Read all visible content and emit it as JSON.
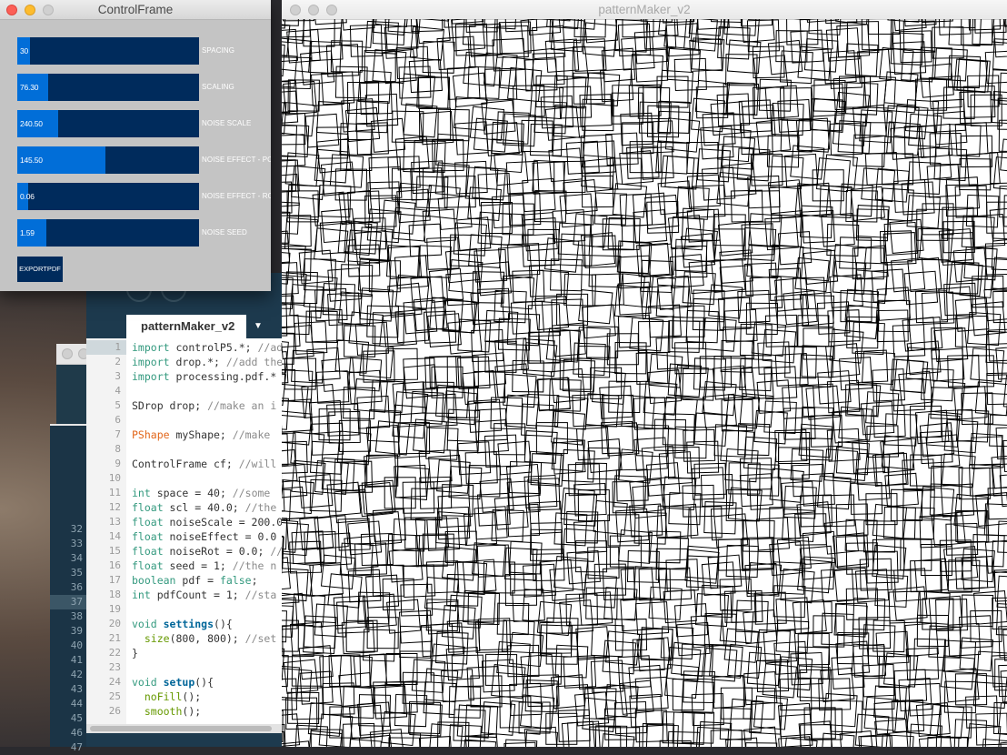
{
  "control_frame": {
    "title": "ControlFrame",
    "sliders": [
      {
        "value_text": "30",
        "label": "SPACING",
        "fill": 0.07
      },
      {
        "value_text": "76.30",
        "label": "SCALING",
        "fill": 0.17
      },
      {
        "value_text": "240.50",
        "label": "NOISE SCALE",
        "fill": 0.225
      },
      {
        "value_text": "145.50",
        "label": "NOISE EFFECT - POS",
        "fill": 0.485
      },
      {
        "value_text": "0.06",
        "label": "NOISE EFFECT - ROT",
        "fill": 0.06
      },
      {
        "value_text": "1.59",
        "label": "NOISE SEED",
        "fill": 0.16
      }
    ],
    "export_button": "EXPORTPDF"
  },
  "pattern_window": {
    "title": "patternMaker_v2"
  },
  "ide": {
    "tab_label": "patternMaker_v2",
    "tab_menu_icon": "chevron-down-icon",
    "current_line": 1,
    "code_lines": [
      [
        [
          "kw",
          "import"
        ],
        [
          "",
          "controlP5.*; "
        ],
        [
          "cm",
          "//ad"
        ]
      ],
      [
        [
          "kw",
          "import"
        ],
        [
          "",
          "drop.*; "
        ],
        [
          "cm",
          "//add the"
        ]
      ],
      [
        [
          "kw",
          "import"
        ],
        [
          "",
          "processing.pdf.*"
        ]
      ],
      [],
      [
        [
          "",
          "SDrop drop; "
        ],
        [
          "cm",
          "//make an i"
        ]
      ],
      [],
      [
        [
          "ty",
          "PShape"
        ],
        [
          "",
          "myShape; "
        ],
        [
          "cm",
          "//make"
        ]
      ],
      [],
      [
        [
          "",
          "ControlFrame cf; "
        ],
        [
          "cm",
          "//will"
        ]
      ],
      [],
      [
        [
          "kw",
          "int"
        ],
        [
          "",
          "space = 40; "
        ],
        [
          "cm",
          "//some"
        ]
      ],
      [
        [
          "kw",
          "float"
        ],
        [
          "",
          "scl = 40.0; "
        ],
        [
          "cm",
          "//the"
        ]
      ],
      [
        [
          "kw",
          "float"
        ],
        [
          "",
          "noiseScale = 200.0"
        ]
      ],
      [
        [
          "kw",
          "float"
        ],
        [
          "",
          "noiseEffect = 0.0"
        ]
      ],
      [
        [
          "kw",
          "float"
        ],
        [
          "",
          "noiseRot = 0.0; "
        ],
        [
          "cm",
          "//"
        ]
      ],
      [
        [
          "kw",
          "float"
        ],
        [
          "",
          "seed = 1; "
        ],
        [
          "cm",
          "//the n"
        ]
      ],
      [
        [
          "kw",
          "boolean"
        ],
        [
          "",
          "pdf = "
        ],
        [
          "kw",
          "false"
        ],
        [
          "",
          ";"
        ]
      ],
      [
        [
          "kw",
          "int"
        ],
        [
          "",
          "pdfCount = 1; "
        ],
        [
          "cm",
          "//sta"
        ]
      ],
      [],
      [
        [
          "kw",
          "void"
        ],
        [
          "fn",
          "settings"
        ],
        [
          "",
          "(){"
        ]
      ],
      [
        [
          "",
          "  "
        ],
        [
          "bfn",
          "size"
        ],
        [
          "",
          "(800, 800); "
        ],
        [
          "cm",
          "//set"
        ]
      ],
      [
        [
          "",
          "}"
        ]
      ],
      [],
      [
        [
          "kw",
          "void"
        ],
        [
          "fn",
          "setup"
        ],
        [
          "",
          "(){"
        ]
      ],
      [
        [
          "",
          "  "
        ],
        [
          "bfn",
          "noFill"
        ],
        [
          "",
          "();"
        ]
      ],
      [
        [
          "",
          "  "
        ],
        [
          "bfn",
          "smooth"
        ],
        [
          "",
          "();"
        ]
      ],
      [
        [
          "",
          "  "
        ]
      ]
    ],
    "line_numbers": [
      "1",
      "2",
      "3",
      "4",
      "5",
      "6",
      "7",
      "8",
      "9",
      "10",
      "11",
      "12",
      "13",
      "14",
      "15",
      "16",
      "17",
      "18",
      "19",
      "20",
      "21",
      "22",
      "23",
      "24",
      "25",
      "26"
    ]
  },
  "background_editor": {
    "line_numbers": [
      "32",
      "33",
      "34",
      "35",
      "36",
      "37",
      "38",
      "39",
      "40",
      "41",
      "42",
      "43",
      "44",
      "45",
      "46",
      "47"
    ],
    "selected_line": "37"
  },
  "colors": {
    "slider_bg": "#002b5c",
    "slider_fill": "#016ed8",
    "control_bg": "#c4c4c4",
    "close": "#fc5f57",
    "minimize": "#fdbc2e"
  }
}
